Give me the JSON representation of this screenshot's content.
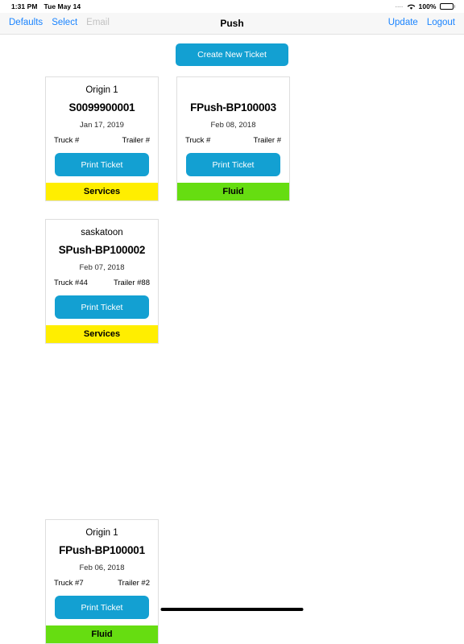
{
  "status_bar": {
    "time": "1:31 PM",
    "date": "Tue May 14",
    "signal_dots": "....",
    "wifi_icon": "wifi-icon",
    "battery_percent": "100%"
  },
  "nav_bar": {
    "title": "Push",
    "left_items": [
      {
        "label": "Defaults",
        "enabled": true
      },
      {
        "label": "Select",
        "enabled": true
      },
      {
        "label": "Email",
        "enabled": false
      }
    ],
    "right_items": [
      {
        "label": "Update",
        "enabled": true
      },
      {
        "label": "Logout",
        "enabled": true
      }
    ]
  },
  "main": {
    "create_button_label": "Create New Ticket",
    "print_button_label": "Print Ticket",
    "tickets": [
      {
        "origin": "Origin 1",
        "number": "S0099900001",
        "date": "Jan 17, 2019",
        "truck": "Truck #",
        "trailer": "Trailer #",
        "category": "Services",
        "category_color": "#FFEE00"
      },
      {
        "origin": "",
        "number": "FPush-BP100003",
        "date": "Feb 08, 2018",
        "truck": "Truck #",
        "trailer": "Trailer #",
        "category": "Fluid",
        "category_color": "#66DD11"
      },
      {
        "origin": "saskatoon",
        "number": "SPush-BP100002",
        "date": "Feb 07, 2018",
        "truck": "Truck #44",
        "trailer": "Trailer #88",
        "category": "Services",
        "category_color": "#FFEE00"
      },
      {
        "origin": "Origin 1",
        "number": "FPush-BP100001",
        "date": "Feb 06, 2018",
        "truck": "Truck #7",
        "trailer": "Trailer #2",
        "category": "Fluid",
        "category_color": "#66DD11"
      }
    ]
  },
  "colors": {
    "accent_blue": "#13a0d2",
    "link_blue": "#1a84ff",
    "yellow": "#FFEE00",
    "green": "#66DD11"
  }
}
